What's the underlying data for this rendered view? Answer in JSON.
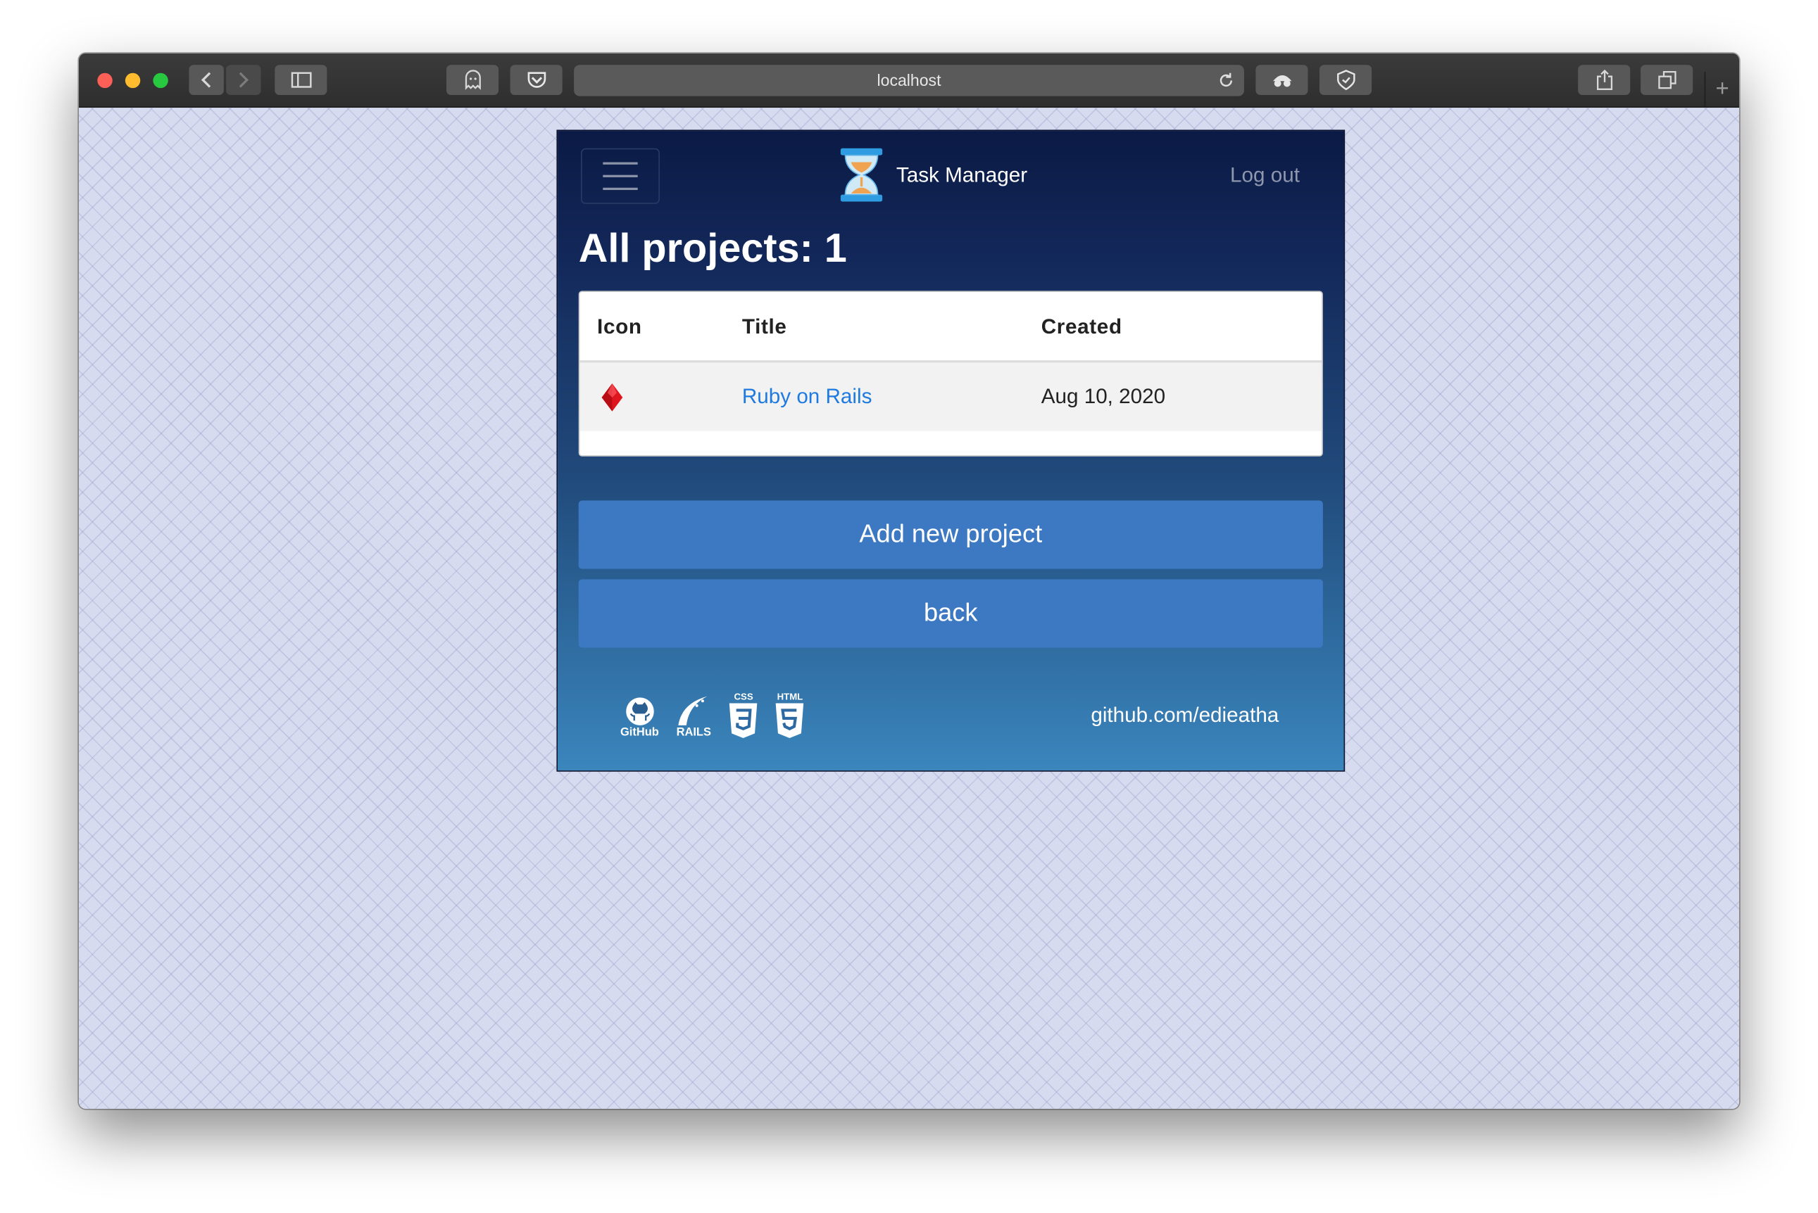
{
  "browser": {
    "url": "localhost"
  },
  "app": {
    "brand": "Task Manager",
    "logout_label": "Log out",
    "page_title": "All projects: 1",
    "table": {
      "columns": [
        "Icon",
        "Title",
        "Created"
      ],
      "rows": [
        {
          "icon": "diamond-icon",
          "title": "Ruby on Rails",
          "created": "Aug 10, 2020"
        }
      ]
    },
    "buttons": {
      "add_project": "Add new project",
      "back": "back"
    },
    "footer": {
      "link": "github.com/edieatha",
      "github_label": "GitHub",
      "rails_label": "RAILS",
      "css_label": "CSS",
      "html_label": "HTML"
    }
  },
  "colors": {
    "accent": "#3c79c2",
    "link": "#1f7ae0",
    "gem": "#e0161e"
  }
}
